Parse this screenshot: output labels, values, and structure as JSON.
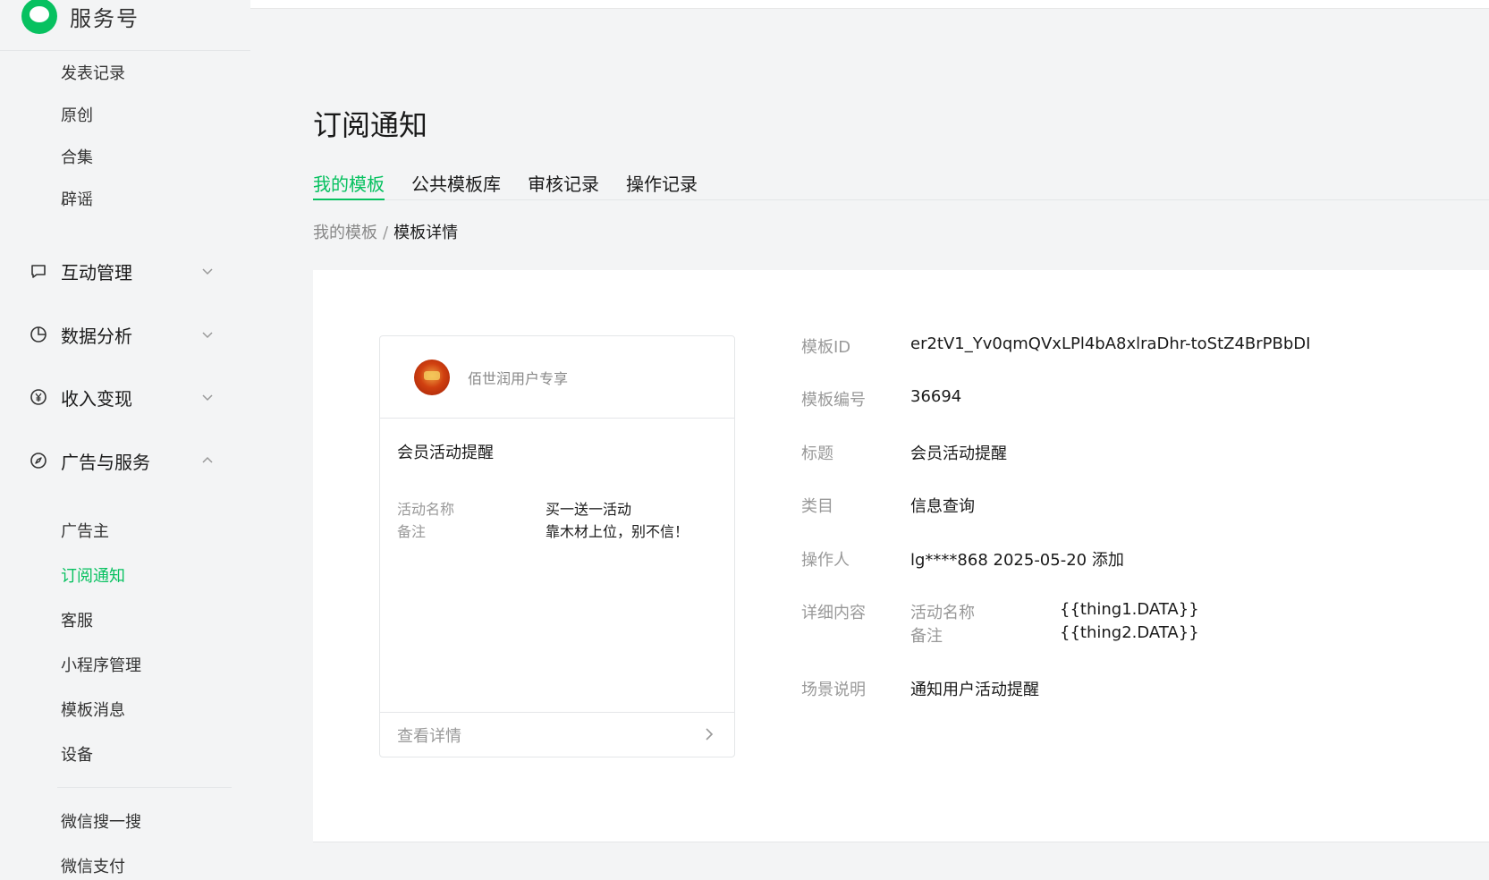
{
  "brand": {
    "name": "服务号"
  },
  "sidebar": {
    "top_items": [
      "发表记录",
      "原创",
      "合集",
      "辟谣"
    ],
    "groups": [
      {
        "label": "互动管理",
        "icon": "comment-icon",
        "expanded": false
      },
      {
        "label": "数据分析",
        "icon": "pie-chart-icon",
        "expanded": false
      },
      {
        "label": "收入变现",
        "icon": "yen-icon",
        "expanded": false
      },
      {
        "label": "广告与服务",
        "icon": "compass-icon",
        "expanded": true
      }
    ],
    "ad_items": [
      "广告主",
      "订阅通知",
      "客服",
      "小程序管理",
      "模板消息",
      "设备"
    ],
    "active_item": "订阅通知",
    "bottom_items": [
      "微信搜一搜",
      "微信支付"
    ]
  },
  "main": {
    "title": "订阅通知",
    "tabs": [
      "我的模板",
      "公共模板库",
      "审核记录",
      "操作记录"
    ],
    "active_tab": "我的模板",
    "breadcrumb": {
      "parent": "我的模板",
      "separator": "/",
      "current": "模板详情"
    }
  },
  "preview": {
    "account_name": "佰世润用户专享",
    "title": "会员活动提醒",
    "fields": [
      {
        "key": "活动名称",
        "value": "买一送一活动"
      },
      {
        "key": "备注",
        "value": "靠木材上位，别不信！"
      }
    ],
    "footer": "查看详情"
  },
  "details": {
    "rows": [
      {
        "label": "模板ID",
        "value": "er2tV1_Yv0qmQVxLPl4bA8xlraDhr-toStZ4BrPBbDI"
      },
      {
        "label": "模板编号",
        "value": "36694"
      },
      {
        "label": "标题",
        "value": "会员活动提醒"
      },
      {
        "label": "类目",
        "value": "信息查询"
      },
      {
        "label": "操作人",
        "value": "lg****868 2025-05-20 添加"
      }
    ],
    "content_label": "详细内容",
    "content_fields": [
      {
        "key": "活动名称",
        "value": "{{thing1.DATA}}"
      },
      {
        "key": "备注",
        "value": "{{thing2.DATA}}"
      }
    ],
    "scene_label": "场景说明",
    "scene_value": "通知用户活动提醒"
  },
  "colors": {
    "accent": "#07c160",
    "muted": "#999999",
    "text": "#1a1a1a"
  }
}
